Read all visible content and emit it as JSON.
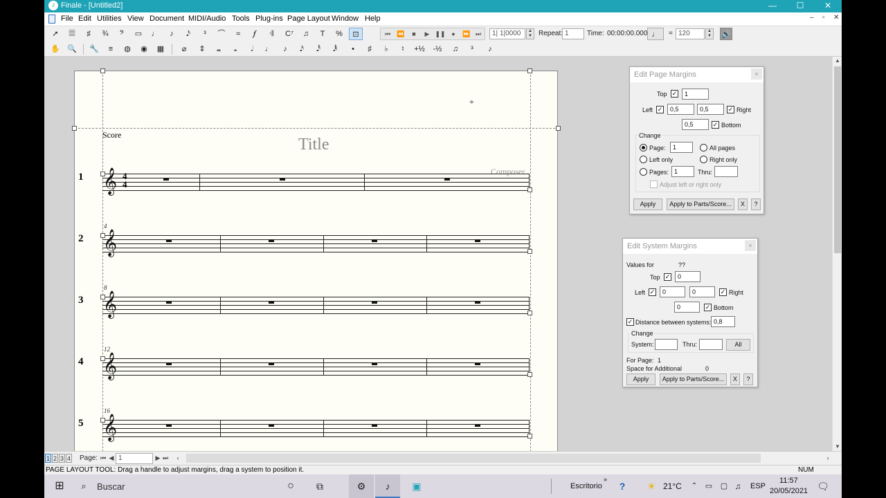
{
  "window": {
    "title": "Finale - [Untitled2]",
    "controls": [
      "—",
      "☐",
      "✕"
    ],
    "mdi_controls": [
      "–",
      "▫",
      "✕"
    ]
  },
  "menu": [
    "File",
    "Edit",
    "Utilities",
    "View",
    "Document",
    "MIDI/Audio",
    "Tools",
    "Plug-ins",
    "Page Layout",
    "Window",
    "Help"
  ],
  "playback": {
    "buttons": [
      "⏮",
      "⏪",
      "■",
      "▶",
      "❚❚",
      "●",
      "⏩",
      "⏭"
    ],
    "counter": "1| 1|0000",
    "repeat_label": "Repeat:",
    "repeat_value": "1",
    "time_label": "Time:",
    "time_value": "00:00:00.000",
    "equals": "=",
    "tempo": "120"
  },
  "score": {
    "label": "Score",
    "title": "Title",
    "composer": "Composer",
    "time_signature": {
      "top": "4",
      "bottom": "4"
    },
    "systems": [
      {
        "number": "1",
        "measure": ""
      },
      {
        "number": "2",
        "measure": "4"
      },
      {
        "number": "3",
        "measure": "8"
      },
      {
        "number": "4",
        "measure": "12"
      },
      {
        "number": "5",
        "measure": "16"
      }
    ]
  },
  "page_margins_dialog": {
    "title": "Edit Page Margins",
    "close": "×",
    "top_label": "Top",
    "top_value": "1",
    "left_label": "Left",
    "left_value": "0,5",
    "right_value": "0,5",
    "right_label": "Right",
    "bottom_value": "0,5",
    "bottom_label": "Bottom",
    "change_label": "Change",
    "page_label": "Page:",
    "page_value": "1",
    "all_pages": "All pages",
    "left_only": "Left only",
    "right_only": "Right only",
    "pages_label": "Pages:",
    "pages_value": "1",
    "thru_label": "Thru:",
    "thru_value": "",
    "adjust_label": "Adjust left or right only",
    "apply": "Apply",
    "apply_parts": "Apply to Parts/Score...",
    "x_btn": "X",
    "help_btn": "?"
  },
  "system_margins_dialog": {
    "title": "Edit System Margins",
    "close": "×",
    "values_for_label": "Values for",
    "values_for_value": "??",
    "top_label": "Top",
    "top_value": "0",
    "left_label": "Left",
    "left_value": "0",
    "right_value": "0",
    "right_label": "Right",
    "bottom_value": "0",
    "bottom_label": "Bottom",
    "distance_label": "Distance between systems:",
    "distance_value": "0,8",
    "change_label": "Change",
    "system_label": "System:",
    "system_value": "",
    "thru_label": "Thru:",
    "thru_value": "",
    "all_btn": "All",
    "for_page_label": "For Page:",
    "for_page_value": "1",
    "space_label": "Space for Additional",
    "space_value": "0",
    "apply": "Apply",
    "apply_parts": "Apply to Parts/Score...",
    "x_btn": "X",
    "help_btn": "?"
  },
  "page_nav": {
    "tabs": [
      "1",
      "2",
      "3",
      "4"
    ],
    "page_label": "Page:",
    "page_value": "1"
  },
  "status": {
    "message": "PAGE LAYOUT TOOL: Drag a handle to adjust margins, drag a system to position it.",
    "num": "NUM"
  },
  "taskbar": {
    "search_placeholder": "Buscar",
    "desktop_label": "Escritorio",
    "weather": "21°C",
    "language": "ESP",
    "time": "11:57",
    "date": "20/05/2021"
  },
  "colors": {
    "titlebar": "#1fa4b7",
    "page_paper": "#fefef6",
    "canvas": "#d3d3d3",
    "taskbar": "#dcd9e2"
  }
}
